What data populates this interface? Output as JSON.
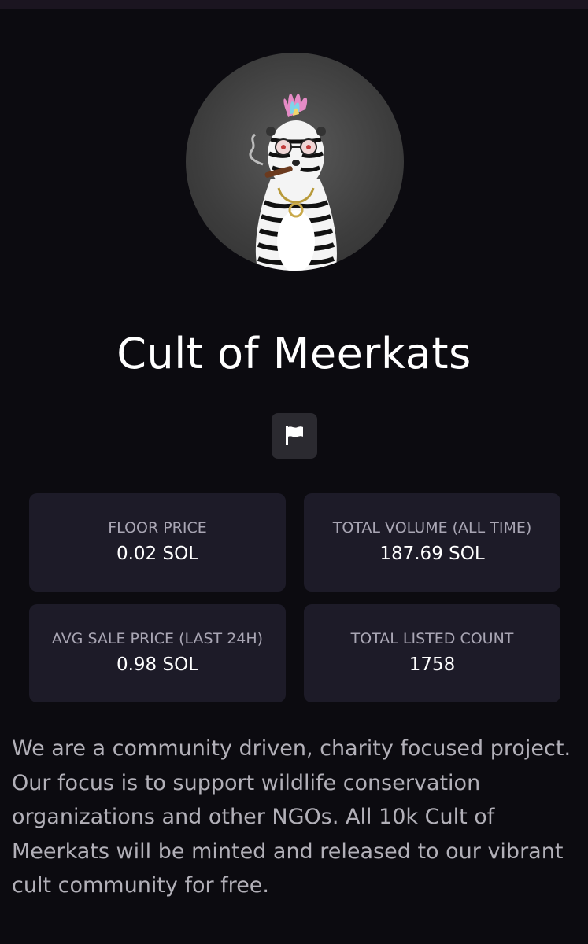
{
  "collection": {
    "name": "Cult of Meerkats",
    "description": "We are a community driven, charity focused project. Our focus is to support wildlife conservation organizations and other NGOs. All 10k Cult of Meerkats will be minted and released to our vibrant cult community for free."
  },
  "report_button": {
    "icon": "flag-icon"
  },
  "stats": [
    {
      "label": "FLOOR PRICE",
      "value": "0.02 SOL"
    },
    {
      "label": "TOTAL VOLUME (ALL TIME)",
      "value": "187.69 SOL"
    },
    {
      "label": "AVG SALE PRICE (LAST 24H)",
      "value": "0.98 SOL"
    },
    {
      "label": "TOTAL LISTED COUNT",
      "value": "1758"
    }
  ],
  "colors": {
    "background": "#0c0b10",
    "card": "#1d1b28",
    "button": "#2b2a30",
    "text_primary": "#ffffff",
    "text_secondary": "#a9a6b4"
  }
}
